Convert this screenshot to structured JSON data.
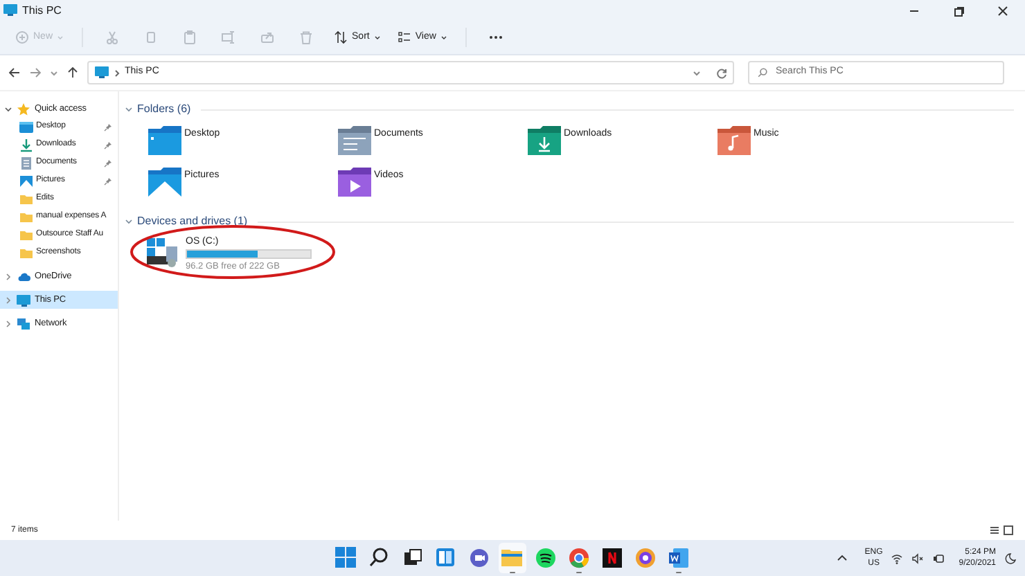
{
  "window": {
    "title": "This PC"
  },
  "toolbar": {
    "buttons": [
      {
        "kind": "new",
        "label": "New",
        "disabled": true
      },
      {
        "kind": "cut",
        "disabled": true
      },
      {
        "kind": "copy",
        "disabled": true
      },
      {
        "kind": "paste",
        "disabled": true
      },
      {
        "kind": "rename",
        "disabled": true
      },
      {
        "kind": "share",
        "disabled": true
      },
      {
        "kind": "delete",
        "disabled": true
      },
      {
        "kind": "sort",
        "label": "Sort",
        "disabled": false
      },
      {
        "kind": "view",
        "label": "View",
        "disabled": false
      },
      {
        "kind": "more",
        "disabled": false
      }
    ]
  },
  "address": {
    "path": "This PC"
  },
  "search": {
    "placeholder": "Search This PC"
  },
  "sidebar": {
    "items": [
      {
        "kind": "star",
        "label": "Quick access",
        "expanded": true,
        "selected": false,
        "children": [
          {
            "kind": "desktop",
            "label": "Desktop",
            "pinned": true,
            "selected": false
          },
          {
            "kind": "downloads",
            "label": "Downloads",
            "pinned": true,
            "selected": false
          },
          {
            "kind": "documents",
            "label": "Documents",
            "pinned": true,
            "selected": false
          },
          {
            "kind": "pictures",
            "label": "Pictures",
            "pinned": true,
            "selected": false
          },
          {
            "kind": "folder",
            "label": "Edits",
            "pinned": false,
            "selected": false
          },
          {
            "kind": "folder",
            "label": "manual expenses A",
            "pinned": false,
            "selected": false
          },
          {
            "kind": "folder",
            "label": "Outsource Staff Au",
            "pinned": false,
            "selected": false
          },
          {
            "kind": "folder",
            "label": "Screenshots",
            "pinned": false,
            "selected": false
          }
        ]
      },
      {
        "kind": "cloud",
        "label": "OneDrive",
        "expanded": false,
        "selected": false
      },
      {
        "kind": "pc",
        "label": "This PC",
        "expanded": false,
        "selected": true
      },
      {
        "kind": "network",
        "label": "Network",
        "expanded": false,
        "selected": false
      }
    ]
  },
  "folders": {
    "title": "Folders (6)",
    "items": [
      {
        "kind": "desktop",
        "label": "Desktop"
      },
      {
        "kind": "documents",
        "label": "Documents"
      },
      {
        "kind": "downloads",
        "label": "Downloads"
      },
      {
        "kind": "music",
        "label": "Music"
      },
      {
        "kind": "pictures",
        "label": "Pictures"
      },
      {
        "kind": "videos",
        "label": "Videos"
      }
    ]
  },
  "drives": {
    "title": "Devices and drives (1)",
    "items": [
      {
        "label": "OS (C:)",
        "level": 0.57,
        "detail": "96.2 GB free of 222 GB"
      }
    ]
  },
  "status_bar": {
    "text": "7 items"
  },
  "taskbar": {
    "apps": [
      {
        "kind": "start",
        "running": false
      },
      {
        "kind": "search",
        "running": false
      },
      {
        "kind": "taskview",
        "running": false
      },
      {
        "kind": "widgets",
        "running": false
      },
      {
        "kind": "chat",
        "running": false
      },
      {
        "kind": "explorer",
        "running": true
      },
      {
        "kind": "spotify",
        "running": false
      },
      {
        "kind": "chrome",
        "running": true
      },
      {
        "kind": "netflix",
        "running": false
      },
      {
        "kind": "browser",
        "running": false
      },
      {
        "kind": "word",
        "running": true
      }
    ],
    "language": "ENG",
    "region": "US",
    "time": "5:24 PM",
    "date": "9/20/2021"
  }
}
